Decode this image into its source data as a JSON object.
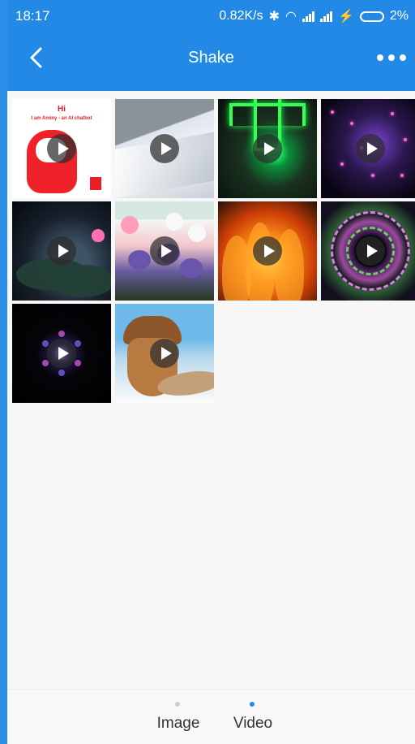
{
  "status": {
    "time": "18:17",
    "network_speed": "0.82K/s",
    "battery": "2%"
  },
  "header": {
    "title": "Shake",
    "back_icon": "chevron-left-icon",
    "more_icon": "more-horizontal-icon"
  },
  "tiles": [
    {
      "kind": "video",
      "thumb": "chatbot",
      "caption_title": "Hi",
      "caption_text": "I am Aminy - an AI chatbot"
    },
    {
      "kind": "video",
      "thumb": "snow"
    },
    {
      "kind": "video",
      "thumb": "green-cross"
    },
    {
      "kind": "video",
      "thumb": "purple-sparkles"
    },
    {
      "kind": "video",
      "thumb": "lotus"
    },
    {
      "kind": "video",
      "thumb": "flowers"
    },
    {
      "kind": "video",
      "thumb": "fire"
    },
    {
      "kind": "video",
      "thumb": "mandala"
    },
    {
      "kind": "video",
      "thumb": "kaleidoscope"
    },
    {
      "kind": "video",
      "thumb": "acorn"
    }
  ],
  "bottom_tabs": [
    {
      "label": "Image",
      "dot_color": "#cfcfcf"
    },
    {
      "label": "Video",
      "dot_color": "#2389e6",
      "selected": true
    }
  ],
  "colors": {
    "header": "#2389e6",
    "background": "#f7f7f7"
  }
}
